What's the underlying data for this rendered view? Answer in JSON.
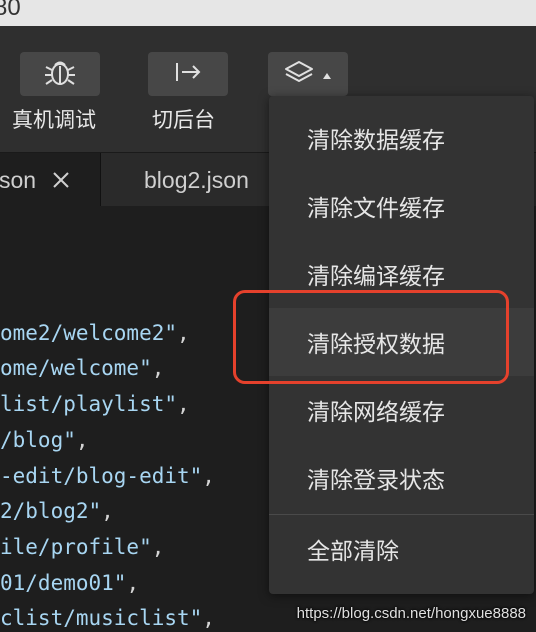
{
  "title": {
    "partial_text": "80"
  },
  "toolbar": {
    "buttons": [
      {
        "label": "真机调试",
        "icon": "bug-icon"
      },
      {
        "label": "切后台",
        "icon": "export-arrow-icon"
      },
      {
        "label": "",
        "icon": "layers-icon"
      }
    ]
  },
  "tabs": [
    {
      "label": "son",
      "icon": "close-icon"
    },
    {
      "label": "blog2.json"
    }
  ],
  "editor": {
    "lines": [
      {
        "str": "ome2/welcome2\"",
        "punct": ","
      },
      {
        "str": "ome/welcome\"",
        "punct": ","
      },
      {
        "str": "list/playlist\"",
        "punct": ","
      },
      {
        "str": "/blog\"",
        "punct": ","
      },
      {
        "str": "-edit/blog-edit\"",
        "punct": ","
      },
      {
        "str": "2/blog2\"",
        "punct": ","
      },
      {
        "str": "ile/profile\"",
        "punct": ","
      },
      {
        "str": "01/demo01\"",
        "punct": ","
      },
      {
        "str": "clist/musiclist\"",
        "punct": ","
      }
    ]
  },
  "menu": {
    "items": [
      {
        "label": "清除数据缓存"
      },
      {
        "label": "清除文件缓存"
      },
      {
        "label": "清除编译缓存"
      },
      {
        "label": "清除授权数据",
        "highlighted": true
      },
      {
        "label": "清除网络缓存"
      },
      {
        "label": "清除登录状态"
      },
      {
        "label": "全部清除"
      }
    ]
  },
  "watermark": "https://blog.csdn.net/hongxue8888",
  "colors": {
    "highlight": "#e5412c",
    "string": "#a8d6f2",
    "menu_bg": "#333333"
  }
}
